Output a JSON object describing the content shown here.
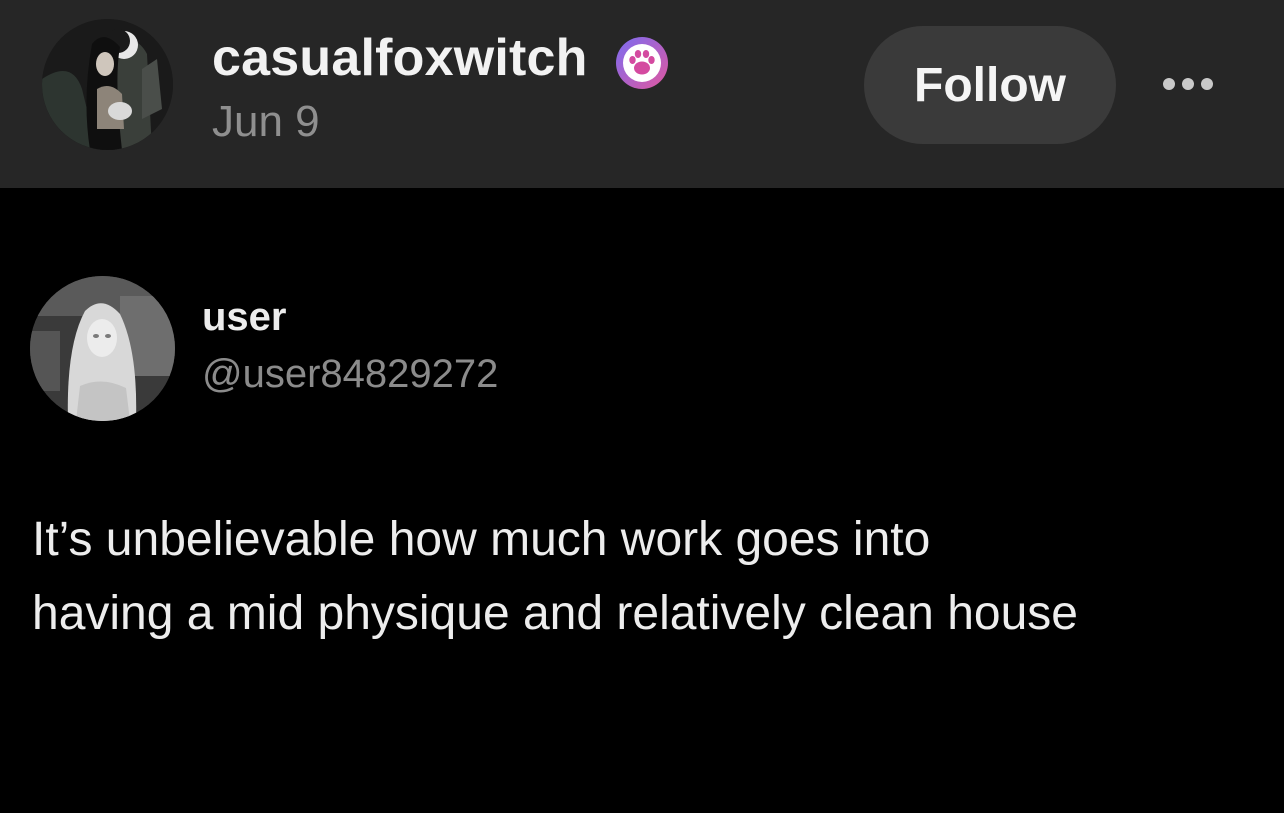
{
  "post": {
    "author": {
      "username": "casualfoxwitch",
      "date": "Jun 9",
      "avatar_icon": "profile-avatar",
      "badge_icon": "paw-badge-icon",
      "badge_color": "#c45ad0"
    },
    "follow_label": "Follow",
    "more_icon": "more-options-icon"
  },
  "quoted_tweet": {
    "display_name": "user",
    "handle": "@user84829272",
    "avatar_icon": "profile-avatar",
    "lines": [
      "It’s unbelievable how much work goes into",
      "having a mid physique and relatively clean house"
    ]
  },
  "colors": {
    "header_bg": "#262626",
    "body_bg": "#000000",
    "button_bg": "#3a3a3a",
    "muted_text": "#8f8f8f"
  }
}
